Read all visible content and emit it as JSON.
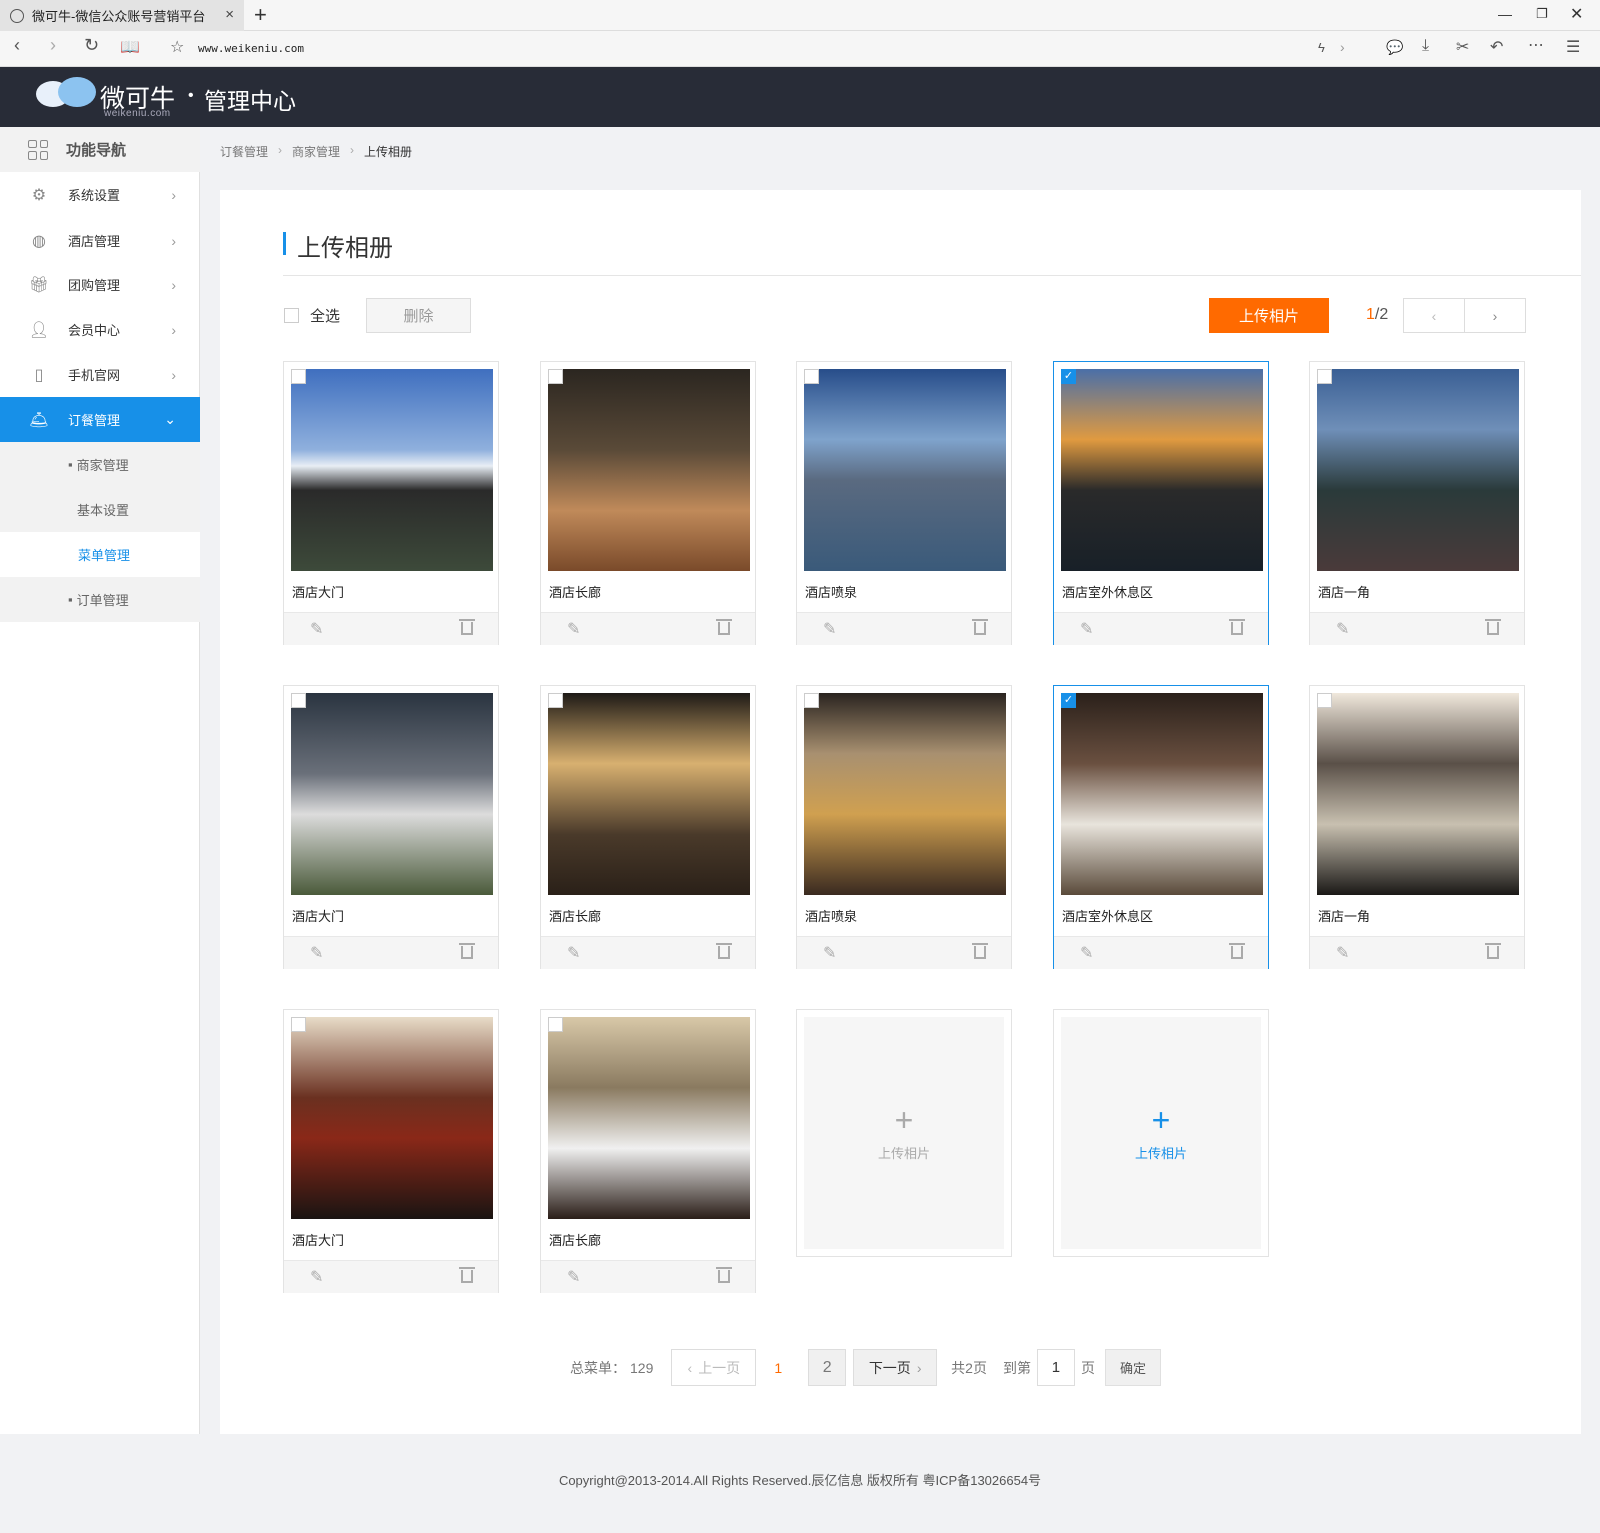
{
  "browser": {
    "tab_title": "微可牛-微信公众账号营销平台",
    "url": "www.weikeniu.com"
  },
  "header": {
    "logo_text": "微可牛",
    "logo_sub": "weikeniu.com",
    "title": "管理中心"
  },
  "sidebar": {
    "nav_title": "功能导航",
    "items": [
      {
        "label": "系统设置",
        "icon": "gear-icon"
      },
      {
        "label": "酒店管理",
        "icon": "hotel-icon"
      },
      {
        "label": "团购管理",
        "icon": "gift-icon"
      },
      {
        "label": "会员中心",
        "icon": "vip-user-icon"
      },
      {
        "label": "手机官网",
        "icon": "phone-icon"
      },
      {
        "label": "订餐管理",
        "icon": "service-bell-icon"
      }
    ],
    "subitems": [
      {
        "label": "商家管理"
      },
      {
        "label": "基本设置"
      },
      {
        "label": "菜单管理"
      },
      {
        "label": "订单管理"
      }
    ]
  },
  "breadcrumb": [
    "订餐管理",
    "商家管理",
    "上传相册"
  ],
  "page": {
    "title": "上传相册",
    "select_all": "全选",
    "delete": "删除",
    "upload": "上传相片",
    "page_current": "1",
    "page_total": "/2"
  },
  "photos": [
    {
      "name": "酒店大门",
      "checked": false
    },
    {
      "name": "酒店长廊",
      "checked": false
    },
    {
      "name": "酒店喷泉",
      "checked": false
    },
    {
      "name": "酒店室外休息区",
      "checked": true
    },
    {
      "name": "酒店一角",
      "checked": false
    },
    {
      "name": "酒店大门",
      "checked": false
    },
    {
      "name": "酒店长廊",
      "checked": false
    },
    {
      "name": "酒店喷泉",
      "checked": false
    },
    {
      "name": "酒店室外休息区",
      "checked": true
    },
    {
      "name": "酒店一角",
      "checked": false
    },
    {
      "name": "酒店大门",
      "checked": false
    },
    {
      "name": "酒店长廊",
      "checked": false
    }
  ],
  "upload_cards": [
    {
      "label": "上传相片"
    },
    {
      "label": "上传相片"
    }
  ],
  "pagination": {
    "total_label": "总菜单：",
    "total": "129",
    "prev": "上一页",
    "pages": [
      "1",
      "2"
    ],
    "next": "下一页",
    "page_count": "共2页",
    "goto_label": "到第",
    "goto_value": "1",
    "page_suffix": "页",
    "confirm": "确定"
  },
  "footer": {
    "copyright": "Copyright@2013-2014.All Rights Reserved.辰亿信息 版权所有 粤ICP备13026654号"
  },
  "colors": {
    "accent": "#1790e8",
    "orange": "#ff6a00",
    "header": "#282c37"
  }
}
